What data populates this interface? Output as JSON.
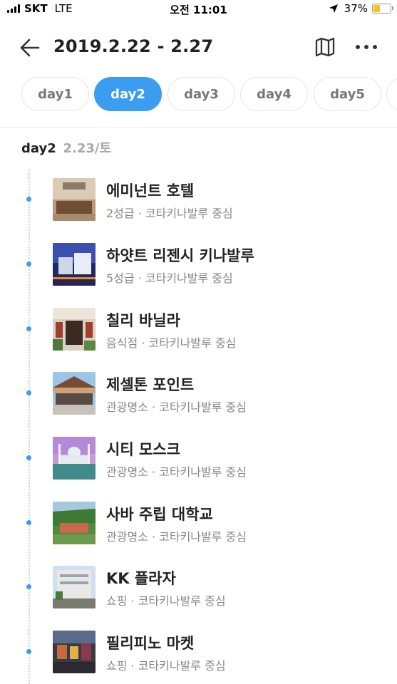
{
  "status_bar": {
    "carrier": "SKT",
    "network": "LTE",
    "time": "오전 11:01",
    "battery": "37%",
    "battery_level": 0.37
  },
  "header": {
    "title": "2019.2.22 - 2.27"
  },
  "tabs": [
    {
      "label": "day1",
      "active": false
    },
    {
      "label": "day2",
      "active": true
    },
    {
      "label": "day3",
      "active": false
    },
    {
      "label": "day4",
      "active": false
    },
    {
      "label": "day5",
      "active": false
    }
  ],
  "day": {
    "label": "day2",
    "date": "2.23/토"
  },
  "places": [
    {
      "name": "에미넌트 호텔",
      "meta": "2성급 · 코타키나발루 중심"
    },
    {
      "name": "하얏트 리젠시 키나발루",
      "meta": "5성급 · 코타키나발루 중심"
    },
    {
      "name": "칠리 바닐라",
      "meta": "음식점 · 코타키나발루 중심"
    },
    {
      "name": "제셀톤 포인트",
      "meta": "관광명소 · 코타키나발루 중심"
    },
    {
      "name": "시티 모스크",
      "meta": "관광명소 · 코타키나발루 중심"
    },
    {
      "name": "사바 주립 대학교",
      "meta": "관광명소 · 코타키나발루 중심"
    },
    {
      "name": "KK 플라자",
      "meta": "쇼핑 · 코타키나발루 중심"
    },
    {
      "name": "필리피노 마켓",
      "meta": "쇼핑 · 코타키나발루 중심"
    }
  ],
  "colors": {
    "accent": "#3a9df0",
    "battery": "#f5c518"
  }
}
